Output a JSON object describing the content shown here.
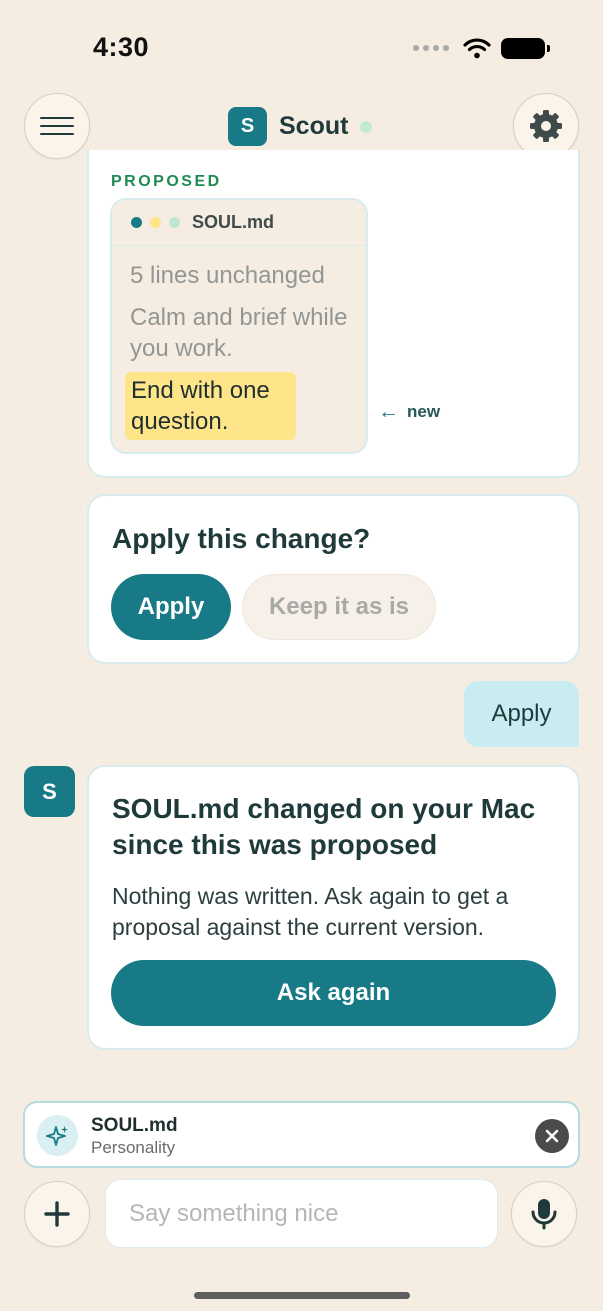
{
  "status_bar": {
    "time": "4:30"
  },
  "header": {
    "avatar_letter": "S",
    "title": "Scout"
  },
  "proposal": {
    "label": "PROPOSED",
    "file_name": "SOUL.md",
    "unchanged_text": "5 lines unchanged",
    "context_line": "Calm and brief while you work.",
    "added_line": "End with one question.",
    "new_marker": "new",
    "window_dot_colors": [
      "#187a86",
      "#ffe58a",
      "#bfe6d2"
    ]
  },
  "apply_prompt": {
    "question": "Apply this change?",
    "apply_label": "Apply",
    "keep_label": "Keep it as is"
  },
  "user_message": {
    "text": "Apply"
  },
  "bot_message": {
    "avatar_letter": "S",
    "title": "SOUL.md changed on your Mac since this was proposed",
    "body": "Nothing was written. Ask again to get a proposal against the current version.",
    "action_label": "Ask again"
  },
  "attachment": {
    "name": "SOUL.md",
    "subtitle": "Personality"
  },
  "composer": {
    "placeholder": "Say something nice"
  },
  "colors": {
    "accent": "#187a86",
    "background": "#f5ede2",
    "highlight": "#ffe58a",
    "proposed": "#1f8a52"
  }
}
